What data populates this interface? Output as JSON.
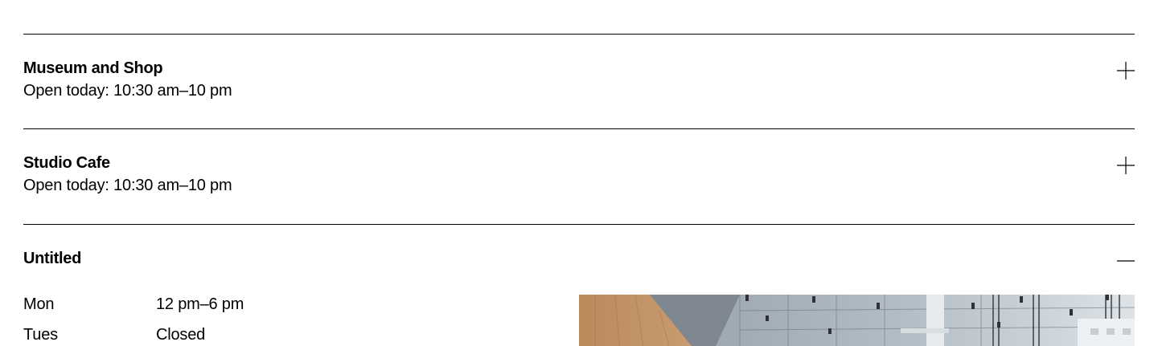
{
  "sections": [
    {
      "title": "Museum and Shop",
      "hours": "Open today: 10:30 am–10 pm",
      "toggle_icon": "plus-icon",
      "expanded": false
    },
    {
      "title": "Studio Cafe",
      "hours": "Open today: 10:30 am–10 pm",
      "toggle_icon": "plus-icon",
      "expanded": false
    },
    {
      "title": "Untitled",
      "toggle_icon": "minus-icon",
      "expanded": true,
      "schedule": [
        {
          "day": "Mon",
          "time": "12 pm–6 pm"
        },
        {
          "day": "Tues",
          "time": "Closed"
        }
      ]
    }
  ],
  "colors": {
    "text": "#000000",
    "rule": "#000000",
    "background": "#ffffff"
  }
}
